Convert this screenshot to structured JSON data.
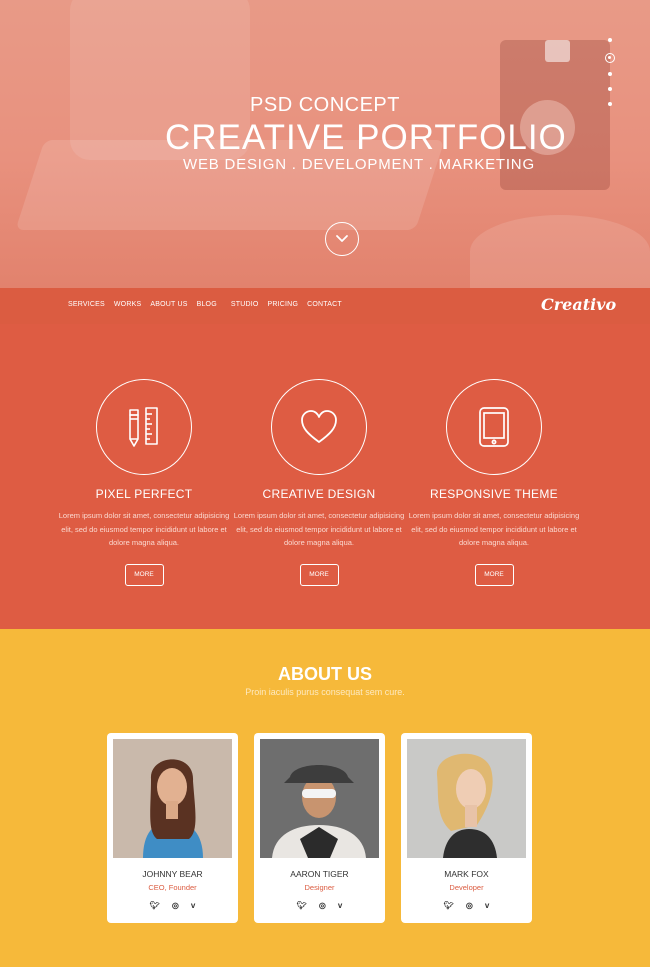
{
  "hero": {
    "subtitle": "PSD CONCEPT",
    "title": "CREATIVE PORTFOLIO",
    "tagline": "WEB DESIGN . DEVELOPMENT . MARKETING"
  },
  "nav": {
    "items": [
      "SERVICES",
      "WORKS",
      "ABOUT US",
      "BLOG",
      "STUDIO",
      "PRICING",
      "CONTACT"
    ],
    "logo": "Creativo"
  },
  "features": [
    {
      "title": "PIXEL PERFECT",
      "text": "Lorem ipsum dolor sit amet, consectetur adipisicing elit, sed do eiusmod tempor incididunt ut labore et dolore magna aliqua.",
      "button": "MORE",
      "icon": "pencil-ruler-icon"
    },
    {
      "title": "CREATIVE DESIGN",
      "text": "Lorem ipsum dolor sit amet, consectetur adipisicing elit, sed do eiusmod tempor incididunt ut labore et dolore magna aliqua.",
      "button": "MORE",
      "icon": "heart-icon"
    },
    {
      "title": "RESPONSIVE THEME",
      "text": "Lorem ipsum dolor sit amet, consectetur adipisicing elit, sed do eiusmod tempor incididunt ut labore et dolore magna aliqua.",
      "button": "MORE",
      "icon": "tablet-icon"
    }
  ],
  "about": {
    "title": "ABOUT US",
    "subtitle": "Proin iaculis purus consequat sem cure.",
    "team": [
      {
        "name": "JOHNNY BEAR",
        "role": "CEO, Founder"
      },
      {
        "name": "AARON TIGER",
        "role": "Designer"
      },
      {
        "name": "MARK FOX",
        "role": "Developer"
      }
    ],
    "social_icons": [
      "twitter-icon",
      "dribbble-icon",
      "vimeo-icon"
    ]
  },
  "colors": {
    "hero": "#e89a87",
    "nav": "#db5c41",
    "features": "#de5c43",
    "about": "#f6b93a",
    "accent": "#db5c41"
  }
}
